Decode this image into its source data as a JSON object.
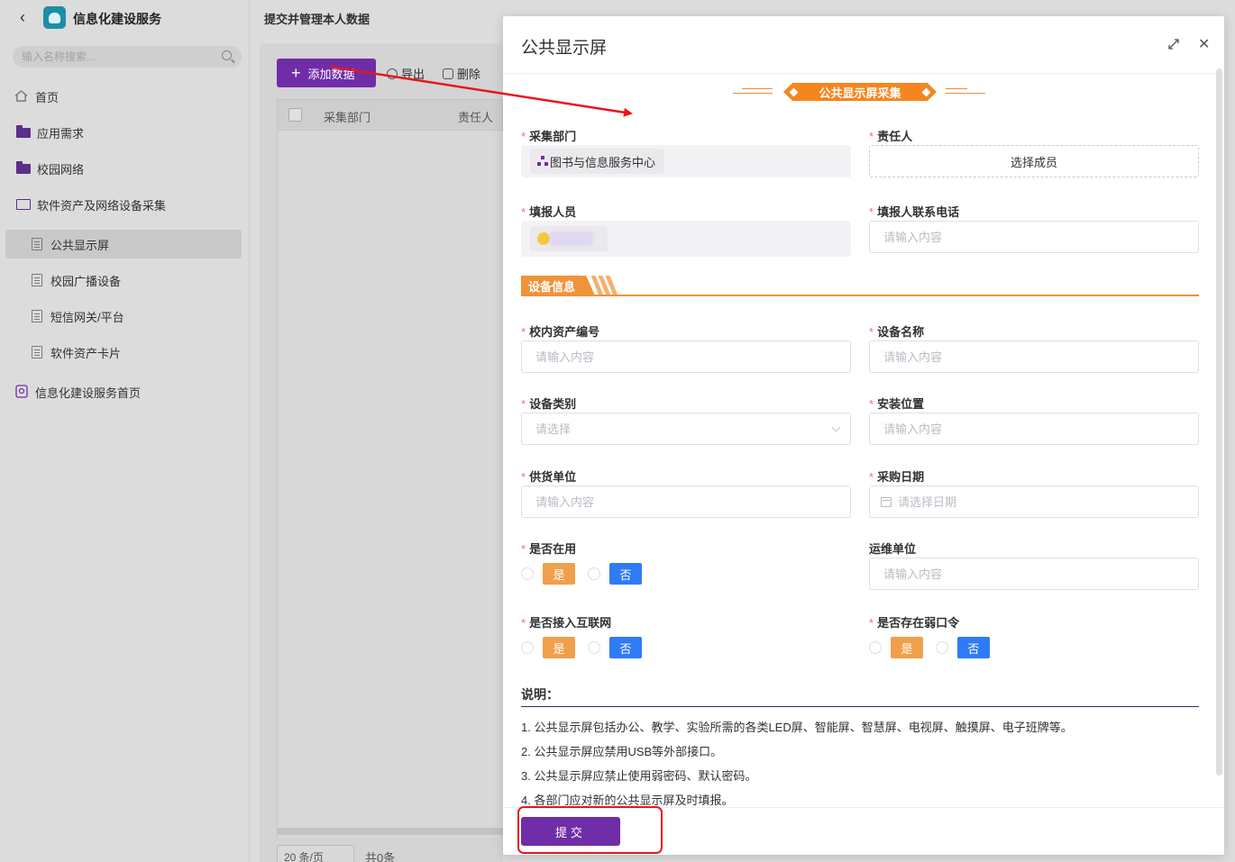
{
  "app": {
    "title": "信息化建设服务",
    "back_icon": "chevron-left-icon",
    "search_placeholder": "输入名称搜索..."
  },
  "sidebar": {
    "items": [
      {
        "label": "首页",
        "icon": "home-icon"
      },
      {
        "label": "应用需求",
        "icon": "folder-icon"
      },
      {
        "label": "校园网络",
        "icon": "folder-icon"
      },
      {
        "label": "软件资产及网络设备采集",
        "icon": "folder-open-icon"
      },
      {
        "label": "公共显示屏",
        "icon": "document-icon",
        "active": true
      },
      {
        "label": "校园广播设备",
        "icon": "document-icon"
      },
      {
        "label": "短信网关/平台",
        "icon": "document-icon"
      },
      {
        "label": "软件资产卡片",
        "icon": "document-icon"
      },
      {
        "label": "信息化建设服务首页",
        "icon": "portal-icon"
      }
    ]
  },
  "main": {
    "title": "提交并管理本人数据",
    "toolbar": {
      "add": "添加数据",
      "export": "导出",
      "delete": "删除"
    },
    "table_headers": [
      "采集部门",
      "责任人"
    ],
    "pager_size": "20 条/页",
    "pager_total": "共0条"
  },
  "modal": {
    "title": "公共显示屏",
    "banner": "公共显示屏采集",
    "section": "设备信息",
    "fields": {
      "dept": {
        "label": "采集部门",
        "value": "图书与信息服务中心"
      },
      "owner": {
        "label": "责任人",
        "button": "选择成员"
      },
      "reporter": {
        "label": "填报人员"
      },
      "phone": {
        "label": "填报人联系电话",
        "placeholder": "请输入内容"
      },
      "asset_no": {
        "label": "校内资产编号",
        "placeholder": "请输入内容"
      },
      "device_name": {
        "label": "设备名称",
        "placeholder": "请输入内容"
      },
      "category": {
        "label": "设备类别",
        "placeholder": "请选择"
      },
      "location": {
        "label": "安装位置",
        "placeholder": "请输入内容"
      },
      "supplier": {
        "label": "供货单位",
        "placeholder": "请输入内容"
      },
      "purchase_date": {
        "label": "采购日期",
        "placeholder": "请选择日期"
      },
      "in_use": {
        "label": "是否在用"
      },
      "maintainer": {
        "label": "运维单位",
        "placeholder": "请输入内容"
      },
      "internet": {
        "label": "是否接入互联网"
      },
      "weak_pwd": {
        "label": "是否存在弱口令"
      }
    },
    "yes": "是",
    "no": "否",
    "notes_title": "说明：",
    "notes": [
      "1. 公共显示屏包括办公、教学、实验所需的各类LED屏、智能屏、智慧屏、电视屏、触摸屏、电子班牌等。",
      "2. 公共显示屏应禁用USB等外部接口。",
      "3. 公共显示屏应禁止使用弱密码、默认密码。",
      "4. 各部门应对新的公共显示屏及时填报。"
    ],
    "submit": "提交"
  },
  "colors": {
    "brand": "#6f2da8",
    "orange": "#f0933a",
    "blue_tag": "#2f7bf5",
    "annotation_red": "#e8151b"
  }
}
